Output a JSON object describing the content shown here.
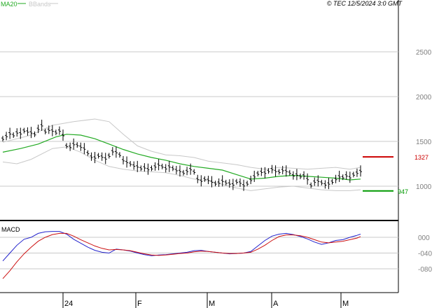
{
  "header": {
    "ma_label": "MA20",
    "bbands_label": "BBands",
    "copyright": "© TEC 12/5/2024 3:0 GMT"
  },
  "macd_panel": {
    "label": "MACD"
  },
  "levels": {
    "resistance": {
      "label": "1327",
      "value": 1327,
      "color": "#cc0000"
    },
    "support": {
      "label": "947",
      "value": 947,
      "color": "#009900"
    }
  },
  "colors": {
    "ma20": "#22aa22",
    "bbands": "#c8c8c8",
    "candles": "#000000",
    "macd_line": "#2222cc",
    "signal_line": "#cc1111",
    "grid": "#c8c8c8",
    "axis_text": "#808080"
  },
  "chart_data": [
    {
      "type": "line",
      "title": "",
      "y_ticks": [
        "1000",
        "1500",
        "2000",
        "2500"
      ],
      "ylim": [
        700,
        3000
      ],
      "x_ticks": [
        "24",
        "F",
        "M",
        "A",
        "M"
      ],
      "grid": true,
      "price_bars": [
        {
          "t": 0,
          "v": 1530
        },
        {
          "t": 1,
          "v": 1560
        },
        {
          "t": 2,
          "v": 1590
        },
        {
          "t": 3,
          "v": 1570
        },
        {
          "t": 4,
          "v": 1600
        },
        {
          "t": 5,
          "v": 1590
        },
        {
          "t": 6,
          "v": 1620
        },
        {
          "t": 7,
          "v": 1610
        },
        {
          "t": 8,
          "v": 1600
        },
        {
          "t": 9,
          "v": 1580
        },
        {
          "t": 10,
          "v": 1640
        },
        {
          "t": 11,
          "v": 1680
        },
        {
          "t": 12,
          "v": 1610
        },
        {
          "t": 13,
          "v": 1630
        },
        {
          "t": 14,
          "v": 1620
        },
        {
          "t": 15,
          "v": 1600
        },
        {
          "t": 16,
          "v": 1620
        },
        {
          "t": 17,
          "v": 1570
        },
        {
          "t": 18,
          "v": 1450
        },
        {
          "t": 19,
          "v": 1440
        },
        {
          "t": 20,
          "v": 1470
        },
        {
          "t": 21,
          "v": 1460
        },
        {
          "t": 22,
          "v": 1440
        },
        {
          "t": 23,
          "v": 1420
        },
        {
          "t": 24,
          "v": 1370
        },
        {
          "t": 25,
          "v": 1330
        },
        {
          "t": 26,
          "v": 1320
        },
        {
          "t": 27,
          "v": 1340
        },
        {
          "t": 28,
          "v": 1330
        },
        {
          "t": 29,
          "v": 1310
        },
        {
          "t": 30,
          "v": 1340
        },
        {
          "t": 31,
          "v": 1390
        },
        {
          "t": 32,
          "v": 1380
        },
        {
          "t": 33,
          "v": 1350
        },
        {
          "t": 34,
          "v": 1290
        },
        {
          "t": 35,
          "v": 1270
        },
        {
          "t": 36,
          "v": 1250
        },
        {
          "t": 37,
          "v": 1230
        },
        {
          "t": 38,
          "v": 1220
        },
        {
          "t": 39,
          "v": 1200
        },
        {
          "t": 40,
          "v": 1210
        },
        {
          "t": 41,
          "v": 1190
        },
        {
          "t": 42,
          "v": 1200
        },
        {
          "t": 43,
          "v": 1220
        },
        {
          "t": 44,
          "v": 1240
        },
        {
          "t": 45,
          "v": 1220
        },
        {
          "t": 46,
          "v": 1200
        },
        {
          "t": 47,
          "v": 1220
        },
        {
          "t": 48,
          "v": 1200
        },
        {
          "t": 49,
          "v": 1180
        },
        {
          "t": 50,
          "v": 1170
        },
        {
          "t": 51,
          "v": 1150
        },
        {
          "t": 52,
          "v": 1170
        },
        {
          "t": 53,
          "v": 1190
        },
        {
          "t": 54,
          "v": 1160
        },
        {
          "t": 55,
          "v": 1080
        },
        {
          "t": 56,
          "v": 1060
        },
        {
          "t": 57,
          "v": 1080
        },
        {
          "t": 58,
          "v": 1070
        },
        {
          "t": 59,
          "v": 1050
        },
        {
          "t": 60,
          "v": 1030
        },
        {
          "t": 61,
          "v": 1040
        },
        {
          "t": 62,
          "v": 1060
        },
        {
          "t": 63,
          "v": 1040
        },
        {
          "t": 64,
          "v": 1030
        },
        {
          "t": 65,
          "v": 1020
        },
        {
          "t": 66,
          "v": 1050
        },
        {
          "t": 67,
          "v": 1040
        },
        {
          "t": 68,
          "v": 1010
        },
        {
          "t": 69,
          "v": 1030
        },
        {
          "t": 70,
          "v": 1070
        },
        {
          "t": 71,
          "v": 1110
        },
        {
          "t": 72,
          "v": 1140
        },
        {
          "t": 73,
          "v": 1160
        },
        {
          "t": 74,
          "v": 1150
        },
        {
          "t": 75,
          "v": 1170
        },
        {
          "t": 76,
          "v": 1190
        },
        {
          "t": 77,
          "v": 1170
        },
        {
          "t": 78,
          "v": 1160
        },
        {
          "t": 79,
          "v": 1180
        },
        {
          "t": 80,
          "v": 1170
        },
        {
          "t": 81,
          "v": 1150
        },
        {
          "t": 82,
          "v": 1120
        },
        {
          "t": 83,
          "v": 1130
        },
        {
          "t": 84,
          "v": 1110
        },
        {
          "t": 85,
          "v": 1120
        },
        {
          "t": 86,
          "v": 1080
        },
        {
          "t": 87,
          "v": 1010
        },
        {
          "t": 88,
          "v": 1050
        },
        {
          "t": 89,
          "v": 1060
        },
        {
          "t": 90,
          "v": 1040
        },
        {
          "t": 91,
          "v": 1020
        },
        {
          "t": 92,
          "v": 1030
        },
        {
          "t": 93,
          "v": 1050
        },
        {
          "t": 94,
          "v": 1080
        },
        {
          "t": 95,
          "v": 1110
        },
        {
          "t": 96,
          "v": 1100
        },
        {
          "t": 97,
          "v": 1120
        },
        {
          "t": 98,
          "v": 1100
        },
        {
          "t": 99,
          "v": 1130
        },
        {
          "t": 100,
          "v": 1150
        },
        {
          "t": 101,
          "v": 1170
        }
      ],
      "ma20": [
        {
          "t": 0,
          "v": 1380
        },
        {
          "t": 5,
          "v": 1420
        },
        {
          "t": 10,
          "v": 1470
        },
        {
          "t": 15,
          "v": 1550
        },
        {
          "t": 18,
          "v": 1580
        },
        {
          "t": 22,
          "v": 1570
        },
        {
          "t": 26,
          "v": 1530
        },
        {
          "t": 30,
          "v": 1470
        },
        {
          "t": 34,
          "v": 1410
        },
        {
          "t": 38,
          "v": 1360
        },
        {
          "t": 42,
          "v": 1320
        },
        {
          "t": 46,
          "v": 1290
        },
        {
          "t": 50,
          "v": 1250
        },
        {
          "t": 54,
          "v": 1220
        },
        {
          "t": 58,
          "v": 1200
        },
        {
          "t": 62,
          "v": 1180
        },
        {
          "t": 66,
          "v": 1130
        },
        {
          "t": 70,
          "v": 1080
        },
        {
          "t": 74,
          "v": 1090
        },
        {
          "t": 78,
          "v": 1110
        },
        {
          "t": 82,
          "v": 1120
        },
        {
          "t": 86,
          "v": 1110
        },
        {
          "t": 90,
          "v": 1100
        },
        {
          "t": 94,
          "v": 1090
        },
        {
          "t": 98,
          "v": 1070
        },
        {
          "t": 101,
          "v": 1080
        }
      ],
      "bband_upper": [
        {
          "t": 0,
          "v": 1490
        },
        {
          "t": 8,
          "v": 1570
        },
        {
          "t": 14,
          "v": 1680
        },
        {
          "t": 20,
          "v": 1720
        },
        {
          "t": 26,
          "v": 1750
        },
        {
          "t": 30,
          "v": 1720
        },
        {
          "t": 34,
          "v": 1580
        },
        {
          "t": 38,
          "v": 1450
        },
        {
          "t": 42,
          "v": 1390
        },
        {
          "t": 46,
          "v": 1350
        },
        {
          "t": 50,
          "v": 1340
        },
        {
          "t": 54,
          "v": 1320
        },
        {
          "t": 58,
          "v": 1280
        },
        {
          "t": 62,
          "v": 1260
        },
        {
          "t": 66,
          "v": 1240
        },
        {
          "t": 70,
          "v": 1210
        },
        {
          "t": 74,
          "v": 1190
        },
        {
          "t": 78,
          "v": 1210
        },
        {
          "t": 82,
          "v": 1200
        },
        {
          "t": 86,
          "v": 1190
        },
        {
          "t": 90,
          "v": 1200
        },
        {
          "t": 94,
          "v": 1210
        },
        {
          "t": 98,
          "v": 1190
        },
        {
          "t": 101,
          "v": 1210
        }
      ],
      "bband_lower": [
        {
          "t": 0,
          "v": 1270
        },
        {
          "t": 4,
          "v": 1250
        },
        {
          "t": 8,
          "v": 1300
        },
        {
          "t": 14,
          "v": 1420
        },
        {
          "t": 18,
          "v": 1440
        },
        {
          "t": 22,
          "v": 1380
        },
        {
          "t": 26,
          "v": 1290
        },
        {
          "t": 30,
          "v": 1220
        },
        {
          "t": 34,
          "v": 1190
        },
        {
          "t": 38,
          "v": 1170
        },
        {
          "t": 42,
          "v": 1160
        },
        {
          "t": 46,
          "v": 1150
        },
        {
          "t": 50,
          "v": 1120
        },
        {
          "t": 54,
          "v": 1080
        },
        {
          "t": 58,
          "v": 1060
        },
        {
          "t": 62,
          "v": 1020
        },
        {
          "t": 66,
          "v": 980
        },
        {
          "t": 70,
          "v": 950
        },
        {
          "t": 74,
          "v": 970
        },
        {
          "t": 78,
          "v": 990
        },
        {
          "t": 82,
          "v": 1000
        },
        {
          "t": 86,
          "v": 980
        },
        {
          "t": 90,
          "v": 960
        },
        {
          "t": 94,
          "v": 950
        },
        {
          "t": 98,
          "v": 950
        },
        {
          "t": 101,
          "v": 960
        }
      ]
    },
    {
      "type": "line",
      "title": "MACD",
      "y_ticks": [
        "000",
        "-040",
        "-080"
      ],
      "ylim": [
        -120,
        20
      ],
      "grid": true,
      "series": [
        {
          "name": "",
          "points": [
            {
              "t": 0,
              "v": -60
            },
            {
              "t": 2,
              "v": -40
            },
            {
              "t": 4,
              "v": -20
            },
            {
              "t": 6,
              "v": -5
            },
            {
              "t": 8,
              "v": 0
            },
            {
              "t": 10,
              "v": 10
            },
            {
              "t": 12,
              "v": 14
            },
            {
              "t": 14,
              "v": 15
            },
            {
              "t": 16,
              "v": 15
            },
            {
              "t": 18,
              "v": 8
            },
            {
              "t": 20,
              "v": -5
            },
            {
              "t": 22,
              "v": -15
            },
            {
              "t": 24,
              "v": -25
            },
            {
              "t": 26,
              "v": -33
            },
            {
              "t": 28,
              "v": -38
            },
            {
              "t": 30,
              "v": -40
            },
            {
              "t": 32,
              "v": -30
            },
            {
              "t": 34,
              "v": -32
            },
            {
              "t": 36,
              "v": -35
            },
            {
              "t": 38,
              "v": -40
            },
            {
              "t": 40,
              "v": -44
            },
            {
              "t": 42,
              "v": -47
            },
            {
              "t": 44,
              "v": -45
            },
            {
              "t": 46,
              "v": -44
            },
            {
              "t": 48,
              "v": -42
            },
            {
              "t": 50,
              "v": -40
            },
            {
              "t": 52,
              "v": -38
            },
            {
              "t": 54,
              "v": -34
            },
            {
              "t": 56,
              "v": -33
            },
            {
              "t": 58,
              "v": -36
            },
            {
              "t": 60,
              "v": -38
            },
            {
              "t": 62,
              "v": -40
            },
            {
              "t": 64,
              "v": -42
            },
            {
              "t": 66,
              "v": -41
            },
            {
              "t": 68,
              "v": -40
            },
            {
              "t": 70,
              "v": -36
            },
            {
              "t": 72,
              "v": -22
            },
            {
              "t": 74,
              "v": -8
            },
            {
              "t": 76,
              "v": 3
            },
            {
              "t": 78,
              "v": 8
            },
            {
              "t": 80,
              "v": 10
            },
            {
              "t": 82,
              "v": 7
            },
            {
              "t": 84,
              "v": 2
            },
            {
              "t": 86,
              "v": -4
            },
            {
              "t": 88,
              "v": -12
            },
            {
              "t": 90,
              "v": -18
            },
            {
              "t": 92,
              "v": -14
            },
            {
              "t": 94,
              "v": -8
            },
            {
              "t": 96,
              "v": -6
            },
            {
              "t": 98,
              "v": 0
            },
            {
              "t": 100,
              "v": 5
            },
            {
              "t": 101,
              "v": 8
            }
          ]
        },
        {
          "name": "",
          "points": [
            {
              "t": 0,
              "v": -105
            },
            {
              "t": 2,
              "v": -85
            },
            {
              "t": 4,
              "v": -62
            },
            {
              "t": 6,
              "v": -42
            },
            {
              "t": 8,
              "v": -25
            },
            {
              "t": 10,
              "v": -10
            },
            {
              "t": 12,
              "v": 0
            },
            {
              "t": 14,
              "v": 7
            },
            {
              "t": 16,
              "v": 10
            },
            {
              "t": 18,
              "v": 10
            },
            {
              "t": 20,
              "v": 3
            },
            {
              "t": 22,
              "v": -6
            },
            {
              "t": 24,
              "v": -14
            },
            {
              "t": 26,
              "v": -22
            },
            {
              "t": 28,
              "v": -28
            },
            {
              "t": 30,
              "v": -32
            },
            {
              "t": 32,
              "v": -31
            },
            {
              "t": 34,
              "v": -32
            },
            {
              "t": 36,
              "v": -34
            },
            {
              "t": 38,
              "v": -38
            },
            {
              "t": 40,
              "v": -42
            },
            {
              "t": 42,
              "v": -45
            },
            {
              "t": 44,
              "v": -46
            },
            {
              "t": 46,
              "v": -45
            },
            {
              "t": 48,
              "v": -43
            },
            {
              "t": 50,
              "v": -41
            },
            {
              "t": 52,
              "v": -40
            },
            {
              "t": 54,
              "v": -37
            },
            {
              "t": 56,
              "v": -35
            },
            {
              "t": 58,
              "v": -36
            },
            {
              "t": 60,
              "v": -38
            },
            {
              "t": 62,
              "v": -40
            },
            {
              "t": 64,
              "v": -41
            },
            {
              "t": 66,
              "v": -41
            },
            {
              "t": 68,
              "v": -40
            },
            {
              "t": 70,
              "v": -38
            },
            {
              "t": 72,
              "v": -30
            },
            {
              "t": 74,
              "v": -20
            },
            {
              "t": 76,
              "v": -8
            },
            {
              "t": 78,
              "v": 2
            },
            {
              "t": 80,
              "v": 6
            },
            {
              "t": 82,
              "v": 6
            },
            {
              "t": 84,
              "v": 4
            },
            {
              "t": 86,
              "v": 0
            },
            {
              "t": 88,
              "v": -6
            },
            {
              "t": 90,
              "v": -12
            },
            {
              "t": 92,
              "v": -14
            },
            {
              "t": 94,
              "v": -12
            },
            {
              "t": 96,
              "v": -10
            },
            {
              "t": 98,
              "v": -6
            },
            {
              "t": 100,
              "v": -2
            },
            {
              "t": 101,
              "v": 2
            }
          ]
        }
      ]
    }
  ]
}
